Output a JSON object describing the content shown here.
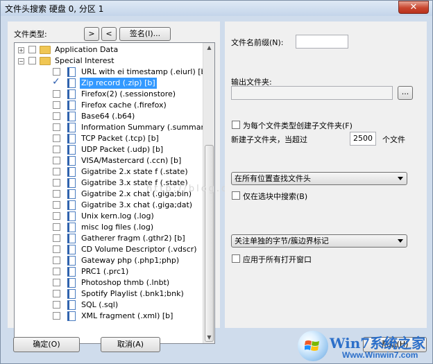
{
  "window": {
    "title": "文件头搜索 硬盘 0, 分区 1",
    "close_glyph": "✕"
  },
  "left": {
    "file_type_label": "文件类型:",
    "next_btn": ">",
    "prev_btn": "<",
    "signature_btn": "签名(I)...",
    "tree": [
      {
        "label": "Application Data",
        "kind": "folder",
        "expander": "+"
      },
      {
        "label": "Special Interest",
        "kind": "folder",
        "expander": "−"
      },
      {
        "label": "URL with ei timestamp (.eiurl) [b]",
        "kind": "file"
      },
      {
        "label": "Zip record (.zip) [b]",
        "kind": "file",
        "checked": true,
        "selected": true
      },
      {
        "label": "Firefox(2) (.sessionstore)",
        "kind": "file"
      },
      {
        "label": "Firefox cache (.firefox)",
        "kind": "file"
      },
      {
        "label": "Base64 (.b64)",
        "kind": "file"
      },
      {
        "label": "Information Summary (.summary)",
        "kind": "file"
      },
      {
        "label": "TCP Packet (.tcp) [b]",
        "kind": "file"
      },
      {
        "label": "UDP Packet (.udp) [b]",
        "kind": "file"
      },
      {
        "label": "VISA/Mastercard (.ccn) [b]",
        "kind": "file"
      },
      {
        "label": "Gigatribe 2.x state f (.state)",
        "kind": "file"
      },
      {
        "label": "Gigatribe 3.x state f (.state)",
        "kind": "file"
      },
      {
        "label": "Gigatribe 2.x chat (.giga;bin)",
        "kind": "file"
      },
      {
        "label": "Gigatribe 3.x chat (.giga;dat)",
        "kind": "file"
      },
      {
        "label": "Unix kern.log (.log)",
        "kind": "file"
      },
      {
        "label": "misc log files (.log)",
        "kind": "file"
      },
      {
        "label": "Gatherer fragm (.gthr2) [b]",
        "kind": "file"
      },
      {
        "label": "CD Volume Descriptor (.vdscr)",
        "kind": "file"
      },
      {
        "label": "Gateway php (.php1;php)",
        "kind": "file"
      },
      {
        "label": "PRC1 (.prc1)",
        "kind": "file"
      },
      {
        "label": "Photoshop thmb (.lnbt)",
        "kind": "file"
      },
      {
        "label": "Spotify Playlist (.bnk1;bnk)",
        "kind": "file"
      },
      {
        "label": "SQL (.sql)",
        "kind": "file"
      },
      {
        "label": "XML fragment (.xml) [b]",
        "kind": "file"
      }
    ]
  },
  "right": {
    "prefix_label": "文件名前缀(N):",
    "prefix_value": "",
    "output_label": "输出文件夹:",
    "output_value": "",
    "browse_btn": "...",
    "subfolder_label": "为每个文件类型创建子文件夹(F)",
    "newfolder_label": "新建子文件夹，当超过",
    "newfolder_value": "2500",
    "newfolder_unit": "个文件",
    "search_scope": "在所有位置查找文件头",
    "selected_only_label": "仅在选块中搜索(B)",
    "boundary_select": "关注单独的字节/簇边界标记",
    "apply_all_label": "应用于所有打开窗口"
  },
  "buttons": {
    "ok": "确定(O)",
    "cancel": "取消(A)",
    "help": "帮助(H)"
  },
  "watermark": "http://blog.c",
  "logo": {
    "text": "Win7系统之家",
    "url": "Www.Winwin7.com"
  },
  "colors": {
    "selection": "#3399ff",
    "window_frame": "#cfdcec",
    "close": "#c9462f"
  }
}
